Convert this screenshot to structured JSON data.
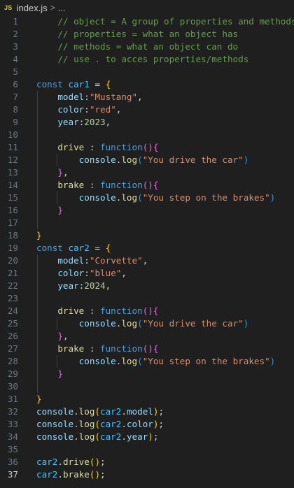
{
  "breadcrumb": {
    "badge": "JS",
    "file": "index.js",
    "separator": ">",
    "more": "..."
  },
  "colors": {
    "background": "#1f1f1f",
    "comment": "#6a9955",
    "keyword": "#569cd6",
    "constant": "#4fc1ff",
    "property": "#9cdcfe",
    "string": "#ce9178",
    "number": "#b5cea8",
    "function": "#dcdcaa",
    "bracket_level_1": "#ffd700",
    "bracket_level_2": "#da70d6",
    "bracket_level_3": "#179fff"
  },
  "editor": {
    "active_line": 37,
    "lines": [
      {
        "n": "1",
        "tokens": [
          [
            "    ",
            "punct"
          ],
          [
            "// object = A group of properties and methods",
            "comment"
          ]
        ]
      },
      {
        "n": "2",
        "tokens": [
          [
            "    ",
            "punct"
          ],
          [
            "// properties = what an object has",
            "comment"
          ]
        ]
      },
      {
        "n": "3",
        "tokens": [
          [
            "    ",
            "punct"
          ],
          [
            "// methods = what an object can do",
            "comment"
          ]
        ]
      },
      {
        "n": "4",
        "tokens": [
          [
            "    ",
            "punct"
          ],
          [
            "// use . to acces properties/methods",
            "comment"
          ]
        ]
      },
      {
        "n": "5",
        "tokens": []
      },
      {
        "n": "6",
        "tokens": [
          [
            "const",
            "keyword"
          ],
          [
            " ",
            "punct"
          ],
          [
            "car1",
            "const"
          ],
          [
            " = ",
            "punct"
          ],
          [
            "{",
            "brace1"
          ]
        ]
      },
      {
        "n": "7",
        "guides": [
          1
        ],
        "tokens": [
          [
            "    ",
            "punct"
          ],
          [
            "model",
            "prop"
          ],
          [
            ":",
            "punct"
          ],
          [
            "\"Mustang\"",
            "string"
          ],
          [
            ",",
            "punct"
          ]
        ]
      },
      {
        "n": "8",
        "guides": [
          1
        ],
        "tokens": [
          [
            "    ",
            "punct"
          ],
          [
            "color",
            "prop"
          ],
          [
            ":",
            "punct"
          ],
          [
            "\"red\"",
            "string"
          ],
          [
            ",",
            "punct"
          ]
        ]
      },
      {
        "n": "9",
        "guides": [
          1
        ],
        "tokens": [
          [
            "    ",
            "punct"
          ],
          [
            "year",
            "prop"
          ],
          [
            ":",
            "punct"
          ],
          [
            "2023",
            "number"
          ],
          [
            ",",
            "punct"
          ]
        ]
      },
      {
        "n": "10",
        "guides": [
          1
        ],
        "tokens": []
      },
      {
        "n": "11",
        "guides": [
          1
        ],
        "tokens": [
          [
            "    ",
            "punct"
          ],
          [
            "drive",
            "func"
          ],
          [
            " : ",
            "punct"
          ],
          [
            "function",
            "keyword"
          ],
          [
            "()",
            "brace2"
          ],
          [
            "{",
            "brace2"
          ]
        ]
      },
      {
        "n": "12",
        "guides": [
          1,
          2
        ],
        "tokens": [
          [
            "        ",
            "punct"
          ],
          [
            "console",
            "var"
          ],
          [
            ".",
            "punct"
          ],
          [
            "log",
            "func"
          ],
          [
            "(",
            "brace3"
          ],
          [
            "\"You drive the car\"",
            "string"
          ],
          [
            ")",
            "brace3"
          ]
        ]
      },
      {
        "n": "13",
        "guides": [
          1
        ],
        "tokens": [
          [
            "    ",
            "punct"
          ],
          [
            "}",
            "brace2"
          ],
          [
            ",",
            "punct"
          ]
        ]
      },
      {
        "n": "14",
        "guides": [
          1
        ],
        "tokens": [
          [
            "    ",
            "punct"
          ],
          [
            "brake",
            "func"
          ],
          [
            " : ",
            "punct"
          ],
          [
            "function",
            "keyword"
          ],
          [
            "()",
            "brace2"
          ],
          [
            "{",
            "brace2"
          ]
        ]
      },
      {
        "n": "15",
        "guides": [
          1,
          2
        ],
        "tokens": [
          [
            "        ",
            "punct"
          ],
          [
            "console",
            "var"
          ],
          [
            ".",
            "punct"
          ],
          [
            "log",
            "func"
          ],
          [
            "(",
            "brace3"
          ],
          [
            "\"You step on the brakes\"",
            "string"
          ],
          [
            ")",
            "brace3"
          ]
        ]
      },
      {
        "n": "16",
        "guides": [
          1
        ],
        "tokens": [
          [
            "    ",
            "punct"
          ],
          [
            "}",
            "brace2"
          ]
        ]
      },
      {
        "n": "17",
        "guides": [
          1
        ],
        "tokens": []
      },
      {
        "n": "18",
        "tokens": [
          [
            "}",
            "brace1"
          ]
        ]
      },
      {
        "n": "19",
        "tokens": [
          [
            "const",
            "keyword"
          ],
          [
            " ",
            "punct"
          ],
          [
            "car2",
            "const"
          ],
          [
            " = ",
            "punct"
          ],
          [
            "{",
            "brace1"
          ]
        ]
      },
      {
        "n": "20",
        "guides": [
          1
        ],
        "tokens": [
          [
            "    ",
            "punct"
          ],
          [
            "model",
            "prop"
          ],
          [
            ":",
            "punct"
          ],
          [
            "\"Corvette\"",
            "string"
          ],
          [
            ",",
            "punct"
          ]
        ]
      },
      {
        "n": "21",
        "guides": [
          1
        ],
        "tokens": [
          [
            "    ",
            "punct"
          ],
          [
            "color",
            "prop"
          ],
          [
            ":",
            "punct"
          ],
          [
            "\"blue\"",
            "string"
          ],
          [
            ",",
            "punct"
          ]
        ]
      },
      {
        "n": "22",
        "guides": [
          1
        ],
        "tokens": [
          [
            "    ",
            "punct"
          ],
          [
            "year",
            "prop"
          ],
          [
            ":",
            "punct"
          ],
          [
            "2024",
            "number"
          ],
          [
            ",",
            "punct"
          ]
        ]
      },
      {
        "n": "23",
        "guides": [
          1
        ],
        "tokens": []
      },
      {
        "n": "24",
        "guides": [
          1
        ],
        "tokens": [
          [
            "    ",
            "punct"
          ],
          [
            "drive",
            "func"
          ],
          [
            " : ",
            "punct"
          ],
          [
            "function",
            "keyword"
          ],
          [
            "()",
            "brace2"
          ],
          [
            "{",
            "brace2"
          ]
        ]
      },
      {
        "n": "25",
        "guides": [
          1,
          2
        ],
        "tokens": [
          [
            "        ",
            "punct"
          ],
          [
            "console",
            "var"
          ],
          [
            ".",
            "punct"
          ],
          [
            "log",
            "func"
          ],
          [
            "(",
            "brace3"
          ],
          [
            "\"You drive the car\"",
            "string"
          ],
          [
            ")",
            "brace3"
          ]
        ]
      },
      {
        "n": "26",
        "guides": [
          1
        ],
        "tokens": [
          [
            "    ",
            "punct"
          ],
          [
            "}",
            "brace2"
          ],
          [
            ",",
            "punct"
          ]
        ]
      },
      {
        "n": "27",
        "guides": [
          1
        ],
        "tokens": [
          [
            "    ",
            "punct"
          ],
          [
            "brake",
            "func"
          ],
          [
            " : ",
            "punct"
          ],
          [
            "function",
            "keyword"
          ],
          [
            "()",
            "brace2"
          ],
          [
            "{",
            "brace2"
          ]
        ]
      },
      {
        "n": "28",
        "guides": [
          1,
          2
        ],
        "tokens": [
          [
            "        ",
            "punct"
          ],
          [
            "console",
            "var"
          ],
          [
            ".",
            "punct"
          ],
          [
            "log",
            "func"
          ],
          [
            "(",
            "brace3"
          ],
          [
            "\"You step on the brakes\"",
            "string"
          ],
          [
            ")",
            "brace3"
          ]
        ]
      },
      {
        "n": "29",
        "guides": [
          1
        ],
        "tokens": [
          [
            "    ",
            "punct"
          ],
          [
            "}",
            "brace2"
          ]
        ]
      },
      {
        "n": "30",
        "guides": [
          1
        ],
        "tokens": []
      },
      {
        "n": "31",
        "tokens": [
          [
            "}",
            "brace1"
          ]
        ]
      },
      {
        "n": "32",
        "tokens": [
          [
            "console",
            "var"
          ],
          [
            ".",
            "punct"
          ],
          [
            "log",
            "func"
          ],
          [
            "(",
            "brace1"
          ],
          [
            "car2",
            "const"
          ],
          [
            ".",
            "punct"
          ],
          [
            "model",
            "prop"
          ],
          [
            ")",
            "brace1"
          ],
          [
            ";",
            "punct"
          ]
        ]
      },
      {
        "n": "33",
        "tokens": [
          [
            "console",
            "var"
          ],
          [
            ".",
            "punct"
          ],
          [
            "log",
            "func"
          ],
          [
            "(",
            "brace1"
          ],
          [
            "car2",
            "const"
          ],
          [
            ".",
            "punct"
          ],
          [
            "color",
            "prop"
          ],
          [
            ")",
            "brace1"
          ],
          [
            ";",
            "punct"
          ]
        ]
      },
      {
        "n": "34",
        "tokens": [
          [
            "console",
            "var"
          ],
          [
            ".",
            "punct"
          ],
          [
            "log",
            "func"
          ],
          [
            "(",
            "brace1"
          ],
          [
            "car2",
            "const"
          ],
          [
            ".",
            "punct"
          ],
          [
            "year",
            "prop"
          ],
          [
            ")",
            "brace1"
          ],
          [
            ";",
            "punct"
          ]
        ]
      },
      {
        "n": "35",
        "tokens": []
      },
      {
        "n": "36",
        "tokens": [
          [
            "car2",
            "const"
          ],
          [
            ".",
            "punct"
          ],
          [
            "drive",
            "func"
          ],
          [
            "()",
            "brace1"
          ],
          [
            ";",
            "punct"
          ]
        ]
      },
      {
        "n": "37",
        "tokens": [
          [
            "car2",
            "const"
          ],
          [
            ".",
            "punct"
          ],
          [
            "brake",
            "func"
          ],
          [
            "()",
            "brace1"
          ],
          [
            ";",
            "punct"
          ]
        ]
      }
    ]
  }
}
